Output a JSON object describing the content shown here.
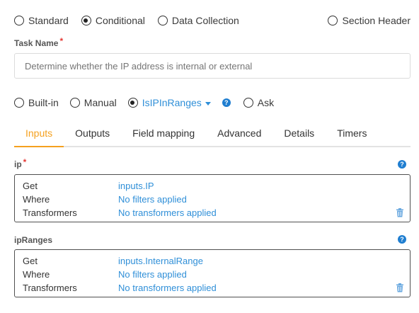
{
  "task_types": [
    {
      "label": "Standard",
      "checked": false
    },
    {
      "label": "Conditional",
      "checked": true
    },
    {
      "label": "Data Collection",
      "checked": false
    },
    {
      "label": "Section Header",
      "checked": false
    }
  ],
  "task_name": {
    "label": "Task Name",
    "required_mark": "*",
    "placeholder": "Determine whether the IP address is internal or external"
  },
  "automation": {
    "options": [
      {
        "label": "Built-in",
        "checked": false
      },
      {
        "label": "Manual",
        "checked": false
      },
      {
        "label": "IsIPInRanges",
        "checked": true
      }
    ],
    "ask_label": "Ask",
    "help_glyph": "?"
  },
  "tabs": [
    {
      "label": "Inputs",
      "active": true
    },
    {
      "label": "Outputs",
      "active": false
    },
    {
      "label": "Field mapping",
      "active": false
    },
    {
      "label": "Advanced",
      "active": false
    },
    {
      "label": "Details",
      "active": false
    },
    {
      "label": "Timers",
      "active": false
    }
  ],
  "arguments": [
    {
      "name": "ip",
      "required_mark": "*",
      "get_label": "Get",
      "get_value": "inputs.IP",
      "where_label": "Where",
      "where_value": "No filters applied",
      "transformers_label": "Transformers",
      "transformers_value": "No transformers applied"
    },
    {
      "name": "ipRanges",
      "required_mark": "",
      "get_label": "Get",
      "get_value": "inputs.InternalRange",
      "where_label": "Where",
      "where_value": "No filters applied",
      "transformers_label": "Transformers",
      "transformers_value": "No transformers applied"
    }
  ],
  "colors": {
    "accent_tab": "#f5a11f",
    "link": "#2f8fd8",
    "help_icon": "#1f7ed0",
    "required": "#e53935",
    "trash_icon": "#6aa9e0"
  },
  "icons": {
    "help": "help-icon",
    "trash": "trash-icon",
    "dropdown": "chevron-down-icon"
  }
}
